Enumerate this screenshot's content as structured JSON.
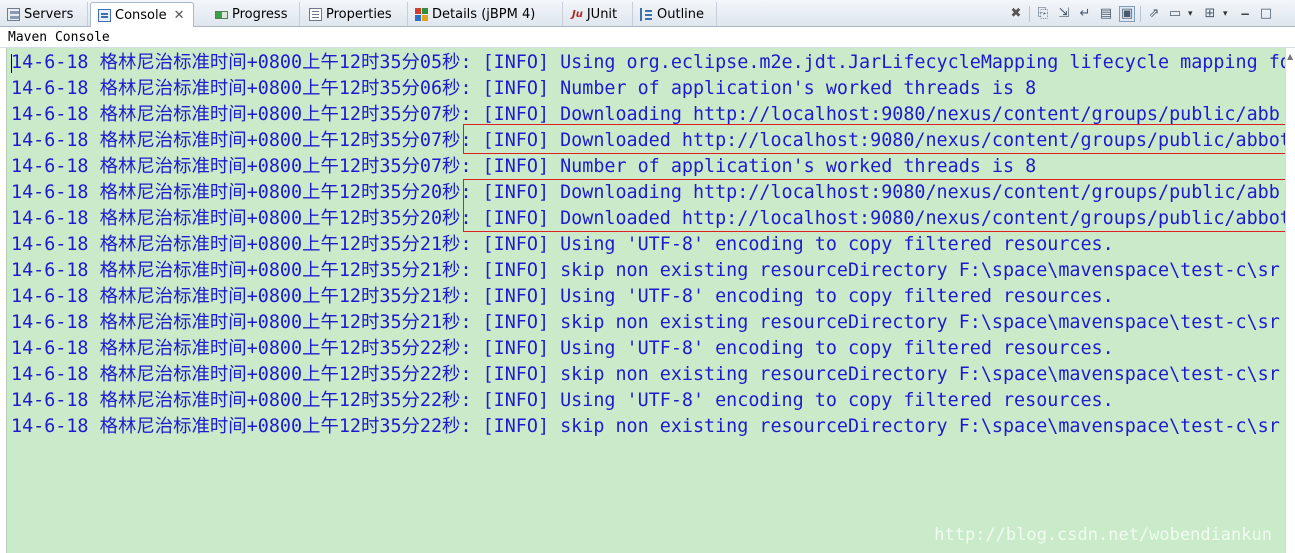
{
  "tabs": [
    {
      "label": "Servers",
      "icon": "servers-icon"
    },
    {
      "label": "Console",
      "icon": "console-icon",
      "active": true
    },
    {
      "label": "Progress",
      "icon": "progress-icon"
    },
    {
      "label": "Properties",
      "icon": "properties-icon"
    },
    {
      "label": "Details (jBPM 4)",
      "icon": "details-icon"
    },
    {
      "label": "JUnit",
      "icon": "junit-icon"
    },
    {
      "label": "Outline",
      "icon": "outline-icon"
    }
  ],
  "junit_glyph": "Ju",
  "console_title": "Maven Console",
  "toolbar": {
    "clear": "✖",
    "minimize": "−",
    "maximize": "□",
    "dropdown": "▾"
  },
  "console_lines": [
    "14-6-18 格林尼治标准时间+0800上午12时35分05秒: [INFO] Using org.eclipse.m2e.jdt.JarLifecycleMapping lifecycle mapping for",
    "14-6-18 格林尼治标准时间+0800上午12时35分06秒: [INFO] Number of application's worked threads is 8",
    "14-6-18 格林尼治标准时间+0800上午12时35分07秒: [INFO] Downloading http://localhost:9080/nexus/content/groups/public/abb",
    "14-6-18 格林尼治标准时间+0800上午12时35分07秒: [INFO] Downloaded http://localhost:9080/nexus/content/groups/public/abbot",
    "14-6-18 格林尼治标准时间+0800上午12时35分07秒: [INFO] Number of application's worked threads is 8",
    "14-6-18 格林尼治标准时间+0800上午12时35分20秒: [INFO] Downloading http://localhost:9080/nexus/content/groups/public/abb",
    "14-6-18 格林尼治标准时间+0800上午12时35分20秒: [INFO] Downloaded http://localhost:9080/nexus/content/groups/public/abbot",
    "14-6-18 格林尼治标准时间+0800上午12时35分21秒: [INFO] Using 'UTF-8' encoding to copy filtered resources.",
    "14-6-18 格林尼治标准时间+0800上午12时35分21秒: [INFO] skip non existing resourceDirectory F:\\space\\mavenspace\\test-c\\sr",
    "14-6-18 格林尼治标准时间+0800上午12时35分21秒: [INFO] Using 'UTF-8' encoding to copy filtered resources.",
    "14-6-18 格林尼治标准时间+0800上午12时35分21秒: [INFO] skip non existing resourceDirectory F:\\space\\mavenspace\\test-c\\sr",
    "14-6-18 格林尼治标准时间+0800上午12时35分22秒: [INFO] Using 'UTF-8' encoding to copy filtered resources.",
    "14-6-18 格林尼治标准时间+0800上午12时35分22秒: [INFO] skip non existing resourceDirectory F:\\space\\mavenspace\\test-c\\sr",
    "14-6-18 格林尼治标准时间+0800上午12时35分22秒: [INFO] Using 'UTF-8' encoding to copy filtered resources.",
    "14-6-18 格林尼治标准时间+0800上午12时35分22秒: [INFO] skip non existing resourceDirectory F:\\space\\mavenspace\\test-c\\sr"
  ],
  "watermark": "http://blog.csdn.net/wobendiankun",
  "colors": {
    "console_bg": "#c9ebc9",
    "console_text": "#1c1ccf",
    "highlight_box": "#e02020"
  }
}
